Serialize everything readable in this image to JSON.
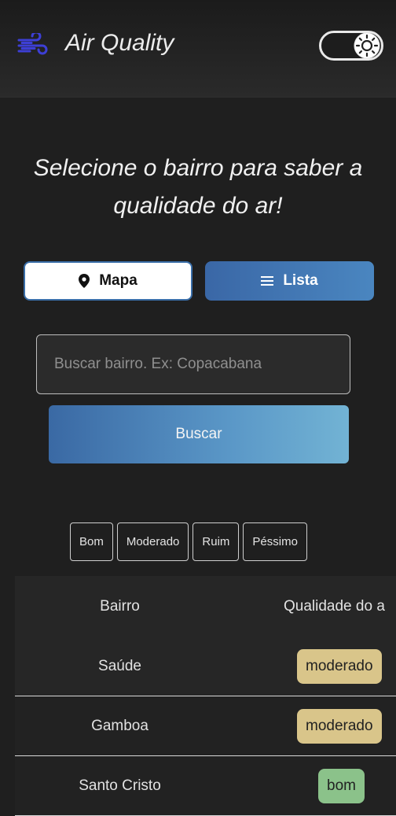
{
  "header": {
    "title": "Air Quality",
    "logo_icon": "wind-icon",
    "theme_toggle_icon": "sun-icon",
    "accent_color": "#3d3fd6"
  },
  "main": {
    "headline": "Selecione o bairro para saber a qualidade do ar!",
    "view_toggle": {
      "mapa_label": "Mapa",
      "mapa_icon": "location-pin-icon",
      "lista_label": "Lista",
      "lista_icon": "list-icon",
      "active": "Lista"
    },
    "search": {
      "placeholder": "Buscar bairro. Ex: Copacabana",
      "value": "",
      "button_label": "Buscar"
    },
    "filters": [
      "Bom",
      "Moderado",
      "Ruim",
      "Péssimo"
    ],
    "table": {
      "headers": [
        "Bairro",
        "Qualidade do a"
      ],
      "rows": [
        {
          "bairro": "Saúde",
          "qualidade": "moderado",
          "color": "#d9c58a"
        },
        {
          "bairro": "Gamboa",
          "qualidade": "moderado",
          "color": "#d9c58a"
        },
        {
          "bairro": "Santo Cristo",
          "qualidade": "bom",
          "color": "#8bc28a"
        }
      ]
    }
  }
}
